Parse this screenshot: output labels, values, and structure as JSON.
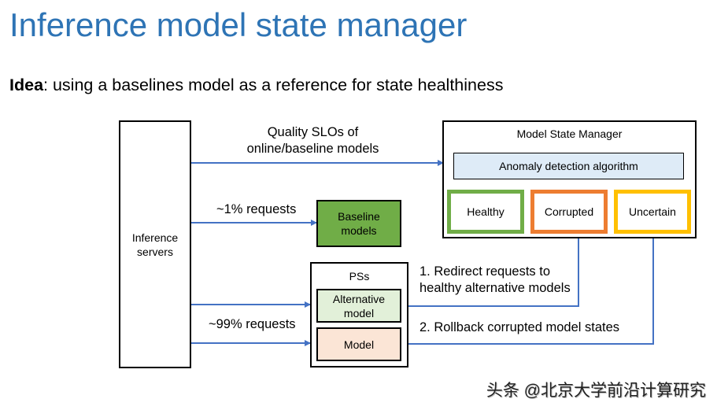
{
  "slide": {
    "title": "Inference model state manager",
    "idea_label": "Idea",
    "idea_text": ": using a baselines model as a reference for state healthiness"
  },
  "diagram": {
    "inference_servers": "Inference servers",
    "baseline_models": "Baseline models",
    "pss": {
      "label": "PSs",
      "alternative_model": "Alternative model",
      "model": "Model"
    },
    "model_state_manager": {
      "label": "Model State Manager",
      "algorithm": "Anomaly detection algorithm",
      "states": [
        {
          "label": "Healthy",
          "color": "#70ad47"
        },
        {
          "label": "Corrupted",
          "color": "#ed7d31"
        },
        {
          "label": "Uncertain",
          "color": "#ffc000"
        }
      ]
    },
    "edges": {
      "quality_slos_line1": "Quality SLOs of",
      "quality_slos_line2": "online/baseline models",
      "one_percent": "~1% requests",
      "ninety_nine_percent": "~99% requests",
      "redirect_line1": "1. Redirect requests to",
      "redirect_line2": "healthy alternative models",
      "rollback": "2. Rollback corrupted model states"
    },
    "colors": {
      "arrow": "#4472c4",
      "title": "#2e74b5",
      "baseline_fill": "#70ad47",
      "algorithm_fill": "#deebf7",
      "alternative_fill": "#e2f0d9",
      "model_fill": "#fbe5d6"
    }
  },
  "watermark": "头条 @北京大学前沿计算研究"
}
